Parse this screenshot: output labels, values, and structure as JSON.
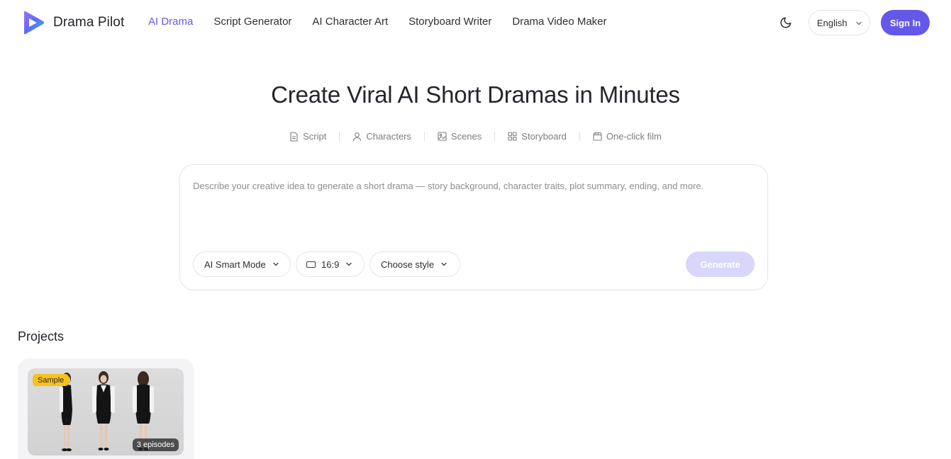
{
  "brand": {
    "name": "Drama Pilot",
    "logo_icon": "play-logo-icon"
  },
  "nav": {
    "items": [
      {
        "label": "AI Drama",
        "active": true
      },
      {
        "label": "Script Generator",
        "active": false
      },
      {
        "label": "AI Character Art",
        "active": false
      },
      {
        "label": "Storyboard Writer",
        "active": false
      },
      {
        "label": "Drama Video Maker",
        "active": false
      }
    ]
  },
  "header": {
    "theme_icon": "moon-icon",
    "language": "English",
    "sign_in_label": "Sign In"
  },
  "hero": {
    "title": "Create Viral AI Short Dramas in Minutes",
    "features": [
      {
        "label": "Script",
        "icon": "document-icon"
      },
      {
        "label": "Characters",
        "icon": "user-icon"
      },
      {
        "label": "Scenes",
        "icon": "image-icon"
      },
      {
        "label": "Storyboard",
        "icon": "grid-icon"
      },
      {
        "label": "One-click film",
        "icon": "clapperboard-icon"
      }
    ]
  },
  "prompt": {
    "placeholder": "Describe your creative idea to generate a short drama — story background, character traits, plot summary, ending, and more.",
    "value": "",
    "mode": "AI Smart Mode",
    "ratio": "16:9",
    "style": "Choose style",
    "generate_label": "Generate"
  },
  "projects": {
    "title": "Projects",
    "items": [
      {
        "badge": "Sample",
        "episodes": "3 episodes"
      }
    ]
  },
  "colors": {
    "accent": "#6358e8",
    "generate_disabled": "#d9d6fb",
    "sample_badge": "#f7c21a"
  }
}
